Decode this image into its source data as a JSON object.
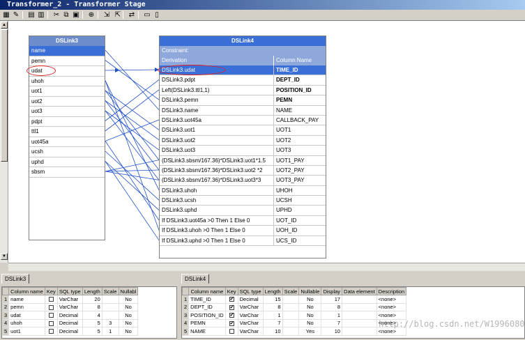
{
  "window": {
    "title": "Transformer_2 - Transformer Stage"
  },
  "toolbar": {
    "buttons": [
      {
        "name": "stage-properties-icon",
        "glyph": "▦"
      },
      {
        "name": "constraints-icon",
        "glyph": "✎"
      },
      {
        "name": "show-all-icon",
        "glyph": "▤"
      },
      {
        "name": "show-selected-icon",
        "glyph": "▥"
      },
      {
        "name": "cut-icon",
        "glyph": "✂"
      },
      {
        "name": "copy-icon",
        "glyph": "⧉"
      },
      {
        "name": "paste-icon",
        "glyph": "▣"
      },
      {
        "name": "find-replace-icon",
        "glyph": "⊕"
      },
      {
        "name": "load-column-icon",
        "glyph": "⇲"
      },
      {
        "name": "save-column-icon",
        "glyph": "⇱"
      },
      {
        "name": "column-auto-match-icon",
        "glyph": "⇄"
      },
      {
        "name": "input-link-order-icon",
        "glyph": "▭"
      },
      {
        "name": "output-link-order-icon",
        "glyph": "▯"
      }
    ]
  },
  "input_link": {
    "title": "DSLink3",
    "columns": [
      "name",
      "pemn",
      "udat",
      "uhoh",
      "uot1",
      "uot2",
      "uot3",
      "pdpt",
      "ttl1",
      "uot45a",
      "ucsh",
      "uphd",
      "sbsm"
    ]
  },
  "output_link": {
    "title": "DSLink4",
    "constraint_label": "Constraint:",
    "header": {
      "derivation": "Derivation",
      "column_name": "Column Name"
    },
    "rows": [
      {
        "derivation": "DSLink3.udat",
        "column": "TIME_ID",
        "bold": true,
        "selected": true
      },
      {
        "derivation": "DSLink3.pdpt",
        "column": "DEPT_ID",
        "bold": true
      },
      {
        "derivation": "Left(DSLink3.ttl1,1)",
        "column": "POSITION_ID",
        "bold": true
      },
      {
        "derivation": "DSLink3.pemn",
        "column": "PEMN",
        "bold": true
      },
      {
        "derivation": "DSLink3.name",
        "column": "NAME"
      },
      {
        "derivation": "DSLink3.uot45a",
        "column": "CALLBACK_PAY"
      },
      {
        "derivation": "DSLink3.uot1",
        "column": "UOT1"
      },
      {
        "derivation": "DSLink3.uot2",
        "column": "UOT2"
      },
      {
        "derivation": "DSLink3.uot3",
        "column": "UOT3"
      },
      {
        "derivation": "(DSLink3.sbsm/167.36)*DSLink3.uot1*1.5",
        "column": "UOT1_PAY"
      },
      {
        "derivation": "(DSLink3.sbsm/167.36)*DSLink3.uot2 *2",
        "column": "UOT2_PAY"
      },
      {
        "derivation": "(DSLink3.sbsm/167.36)*DSLink3.uot3*3",
        "column": "UOT3_PAY"
      },
      {
        "derivation": "DSLink3.uhoh",
        "column": "UHOH"
      },
      {
        "derivation": "DSLink3.ucsh",
        "column": "UCSH"
      },
      {
        "derivation": "DSLink3.uphd",
        "column": "UPHD"
      },
      {
        "derivation": "If DSLink3.uot45a >0 Then 1 Else  0",
        "column": "UOT_ID"
      },
      {
        "derivation": "If DSLink3.uhoh >0 Then 1 Else  0",
        "column": "UOH_ID"
      },
      {
        "derivation": "If DSLink3.uphd >0 Then 1 Else  0",
        "column": "UCS_ID"
      }
    ]
  },
  "input_grid": {
    "tab": "DSLink3",
    "headers": [
      "",
      "Column name",
      "Key",
      "SQL type",
      "Length",
      "Scale",
      "Nullabl"
    ],
    "rows": [
      [
        "1",
        "name",
        "",
        "VarChar",
        "20",
        "",
        "No"
      ],
      [
        "2",
        "pemn",
        "",
        "VarChar",
        "8",
        "",
        "No"
      ],
      [
        "3",
        "udat",
        "",
        "Decimal",
        "4",
        "",
        "No"
      ],
      [
        "4",
        "uhoh",
        "",
        "Decimal",
        "5",
        "3",
        "No"
      ],
      [
        "5",
        "uot1",
        "",
        "Decimal",
        "5",
        "1",
        "No"
      ]
    ]
  },
  "output_grid": {
    "tab": "DSLink4",
    "headers": [
      "",
      "Column name",
      "Key",
      "SQL type",
      "Length",
      "Scale",
      "Nullable",
      "Display",
      "Data element",
      "Description"
    ],
    "rows": [
      [
        "1",
        "TIME_ID",
        "✔",
        "Decimal",
        "15",
        "",
        "No",
        "17",
        "",
        "<none>"
      ],
      [
        "2",
        "DEPT_ID",
        "✔",
        "VarChar",
        "8",
        "",
        "No",
        "8",
        "",
        "<none>"
      ],
      [
        "3",
        "POSITION_ID",
        "✔",
        "VarChar",
        "1",
        "",
        "No",
        "1",
        "",
        "<none>"
      ],
      [
        "4",
        "PEMN",
        "✔",
        "VarChar",
        "7",
        "",
        "No",
        "7",
        "",
        "<none>"
      ],
      [
        "5",
        "NAME",
        "",
        "VarChar",
        "10",
        "",
        "Yes",
        "10",
        "",
        "<none>"
      ]
    ]
  },
  "watermark": "http://blog.csdn.net/W19960809"
}
